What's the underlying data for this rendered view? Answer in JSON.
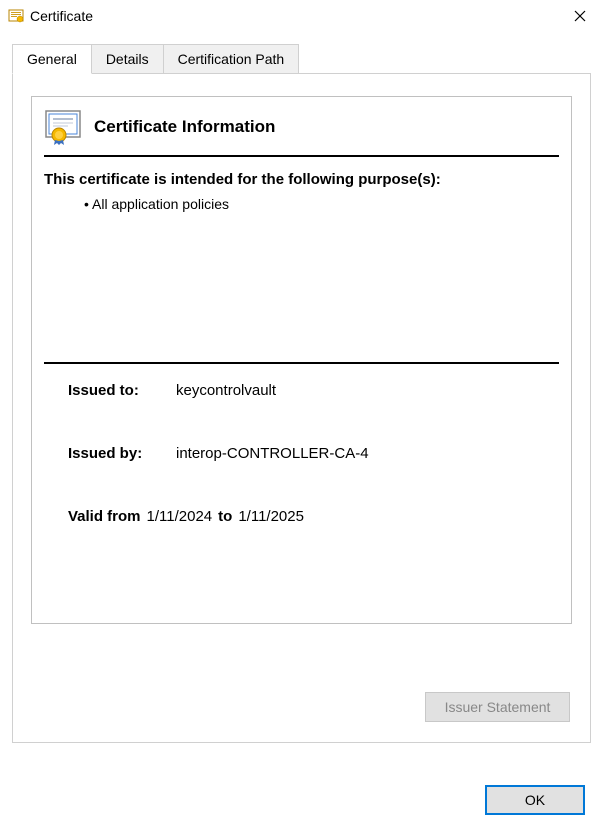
{
  "window": {
    "title": "Certificate"
  },
  "tabs": [
    {
      "label": "General",
      "active": true
    },
    {
      "label": "Details",
      "active": false
    },
    {
      "label": "Certification Path",
      "active": false
    }
  ],
  "cert": {
    "info_heading": "Certificate Information",
    "purpose_heading": "This certificate is intended for the following purpose(s):",
    "purposes": [
      "All application policies"
    ],
    "issued_to_label": "Issued to:",
    "issued_to_value": "keycontrolvault",
    "issued_by_label": "Issued by:",
    "issued_by_value": "interop-CONTROLLER-CA-4",
    "valid_from_label": "Valid from",
    "valid_from_value": "1/11/2024",
    "valid_to_label": "to",
    "valid_to_value": "1/11/2025"
  },
  "buttons": {
    "issuer_statement": "Issuer Statement",
    "ok": "OK"
  }
}
